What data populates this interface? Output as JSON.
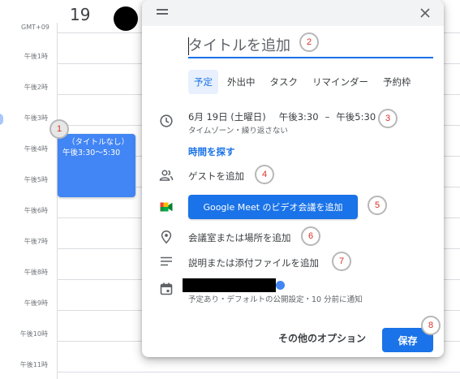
{
  "calendar": {
    "day_number": "19",
    "timezone": "GMT+09",
    "hours": [
      "午後1時",
      "午後2時",
      "午後3時",
      "午後4時",
      "午後5時",
      "午後6時",
      "午後7時",
      "午後8時",
      "午後9時",
      "午後10時",
      "午後11時"
    ],
    "event": {
      "title": "（タイトルなし）",
      "time": "午後3:30～5:30"
    }
  },
  "dialog": {
    "title_placeholder": "タイトルを追加",
    "tabs": [
      "予定",
      "外出中",
      "タスク",
      "リマインダー",
      "予約枠"
    ],
    "active_tab": "予定",
    "date": "6月 19日 (土曜日)",
    "start_time": "午後3:30",
    "time_separator": "–",
    "end_time": "午後5:30",
    "timezone_repeat": "タイムゾーン・繰り返さない",
    "find_time": "時間を探す",
    "add_guests": "ゲストを追加",
    "meet_button": "Google Meet のビデオ会議を追加",
    "add_location": "会議室または場所を追加",
    "add_description": "説明または添付ファイルを追加",
    "calendar_settings": "予定あり・デフォルトの公開設定・10 分前に通知",
    "more_options": "その他のオプション",
    "save": "保存"
  },
  "annotations": [
    "1",
    "2",
    "3",
    "4",
    "5",
    "6",
    "7",
    "8"
  ],
  "icons": {
    "drag": "drag-handle-icon",
    "close": "close-icon",
    "clock": "clock-icon",
    "guests": "people-icon",
    "meet": "google-meet-icon",
    "location": "location-pin-icon",
    "description": "notes-icon",
    "calendar": "calendar-icon"
  },
  "colors": {
    "accent": "#1a73e8",
    "event": "#4285f4",
    "annotation_number": "#d93025"
  }
}
